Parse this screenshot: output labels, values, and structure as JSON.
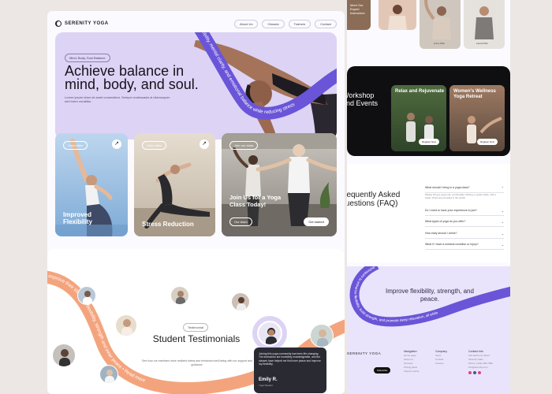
{
  "left_page": {
    "brand": "SERENITY YOGA",
    "nav": [
      "About Us",
      "Classes",
      "Trainers",
      "Contact"
    ],
    "hero": {
      "pill": "Mind, Body, Soul Balance",
      "title": "Achieve balance in mind, body, and soul.",
      "body": "Lorem ipsum dolor sit amet consectetur. Semper malesuada ut ullamcorper sed tortor curabitur.",
      "ribbon_text": "flexibility, mental clarity, and emotional balance while reducing stress"
    },
    "cards": [
      {
        "button": "View video",
        "title": "Improved Flexibility",
        "arrow": "↗"
      },
      {
        "button": "View video",
        "title": "Stress Reduction",
        "arrow": "↗"
      },
      {
        "button": "Join our class",
        "title": "Join Us for a Yoga Class Today!",
        "btn_left": "Our team",
        "btn_right": "Get started"
      }
    ],
    "testimonials": {
      "pill": "Testimonial",
      "title": "Student Testimonials",
      "body": "See how our members have realized stress and enhanced well-being with our support and guidance.",
      "ribbon_text": "improve their lifestyle • flexibility, strength and inner peace • Read more",
      "quote": {
        "text": "Joining this yoga community has been life-changing. The instructors are incredibly knowledgeable, and the classes have helped me find inner peace and improve my flexibility.",
        "name": "Emily R.",
        "role": "Yoga Student"
      }
    }
  },
  "right_page": {
    "instructors": {
      "title": "Meet Our Expert Instructors",
      "names": [
        "",
        "Anna Park",
        "Laura Park"
      ]
    },
    "workshop": {
      "title": "Workshop and Events",
      "cards": [
        {
          "title": "Relax and Rejuvenate",
          "button": "Register Now"
        },
        {
          "title": "Women's Wellness Yoga Retreat",
          "button": "Register Now"
        }
      ]
    },
    "faq": {
      "title": "Frequently Asked Questions (FAQ)",
      "items": [
        {
          "q": "What should I bring to a yoga class?",
          "a": "Please bring a yoga mat, comfortable clothing, a water bottle, and a towel. Props are provided in the studio."
        },
        {
          "q": "Do I need to have prior experience to join?",
          "a": ""
        },
        {
          "q": "What types of yoga do you offer?",
          "a": ""
        },
        {
          "q": "How early should I arrive?",
          "a": ""
        },
        {
          "q": "What if I have a medical condition or injury?",
          "a": ""
        }
      ]
    },
    "footer": {
      "title": "Improve flexibility, strength, and peace.",
      "ribbon_text": "techniques to enhance flexibility, build strength, and promote deep relaxation, all while",
      "brand": "SERENITY YOGA",
      "subscribe": "Subscribe",
      "columns": [
        {
          "heading": "Navigation",
          "items": [
            "Home page",
            "About us",
            "Services",
            "Pricing plans",
            "Support center"
          ]
        },
        {
          "heading": "Company",
          "items": [
            "Team",
            "Contact",
            "Careers"
          ]
        },
        {
          "heading": "Contact Info",
          "items": [
            "123 Harmony Street",
            "Serenity Suite",
            "Phone: (123) 456-7890",
            "info@serenity.com"
          ]
        }
      ]
    }
  },
  "colors": {
    "lavender": "#ddd3f5",
    "purple": "#6a55d8",
    "peach": "#f4a47d",
    "dark": "#15131c"
  }
}
